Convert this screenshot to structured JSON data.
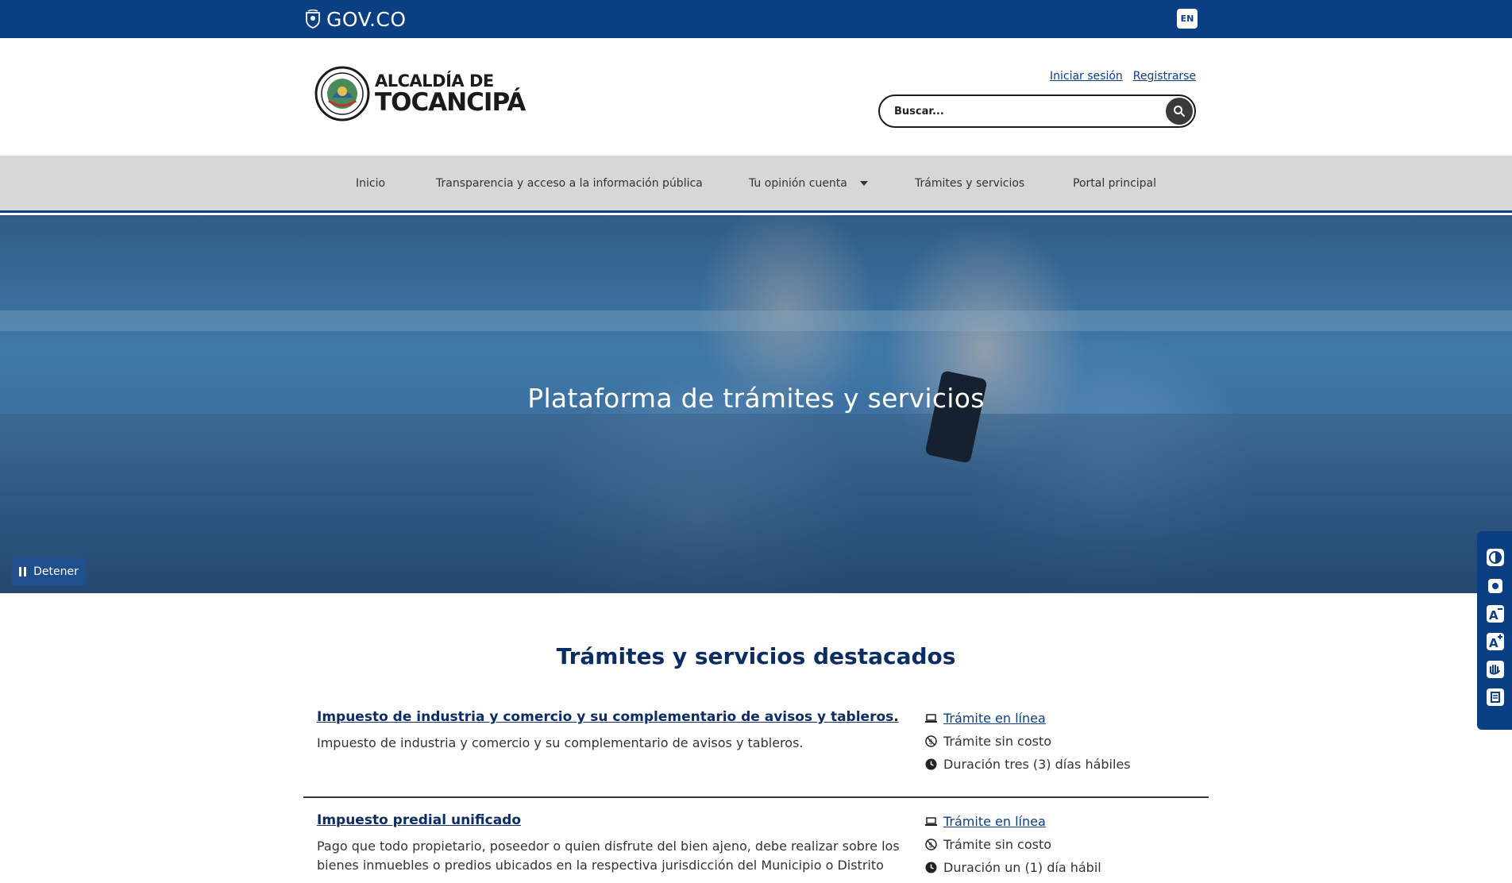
{
  "govbar": {
    "brand": "GOV.CO",
    "lang": "EN"
  },
  "header": {
    "logo_line1": "ALCALDÍA DE",
    "logo_line2": "TOCANCIPÁ",
    "login": "Iniciar sesión",
    "register": "Registrarse",
    "search_placeholder": "Buscar..."
  },
  "nav": {
    "items": [
      {
        "label": "Inicio"
      },
      {
        "label": "Transparencia y acceso a la información pública"
      },
      {
        "label": "Tu opinión cuenta"
      },
      {
        "label": "Trámites y servicios"
      },
      {
        "label": "Portal principal"
      }
    ]
  },
  "hero": {
    "title": "Plataforma de trámites y servicios",
    "stop_label": "Detener"
  },
  "featured": {
    "title": "Trámites y servicios destacados",
    "items": [
      {
        "name": "Impuesto de industria y comercio y su complementario de avisos y tableros.",
        "description": "Impuesto de industria y comercio y su complementario de avisos y tableros.",
        "online": "Trámite en línea",
        "cost": "Trámite sin costo",
        "duration": "Duración tres (3) días hábiles"
      },
      {
        "name": "Impuesto predial unificado",
        "description": "Pago que todo propietario, poseedor o quien disfrute del bien ajeno, debe realizar sobre los bienes inmuebles o predios ubicados en la respectiva jurisdicción del Municipio o Distrito",
        "online": "Trámite en línea",
        "cost": "Trámite sin costo",
        "duration": "Duración un (1) día hábil"
      }
    ]
  },
  "accessibility": {
    "icons": [
      "contrast-icon",
      "dark-mode-icon",
      "decrease-font-icon",
      "increase-font-icon",
      "sign-language-icon",
      "relief-center-icon"
    ]
  },
  "colors": {
    "primary": "#0b3f84",
    "title": "#0b2d63",
    "nav_bg": "#d7d7d7"
  }
}
